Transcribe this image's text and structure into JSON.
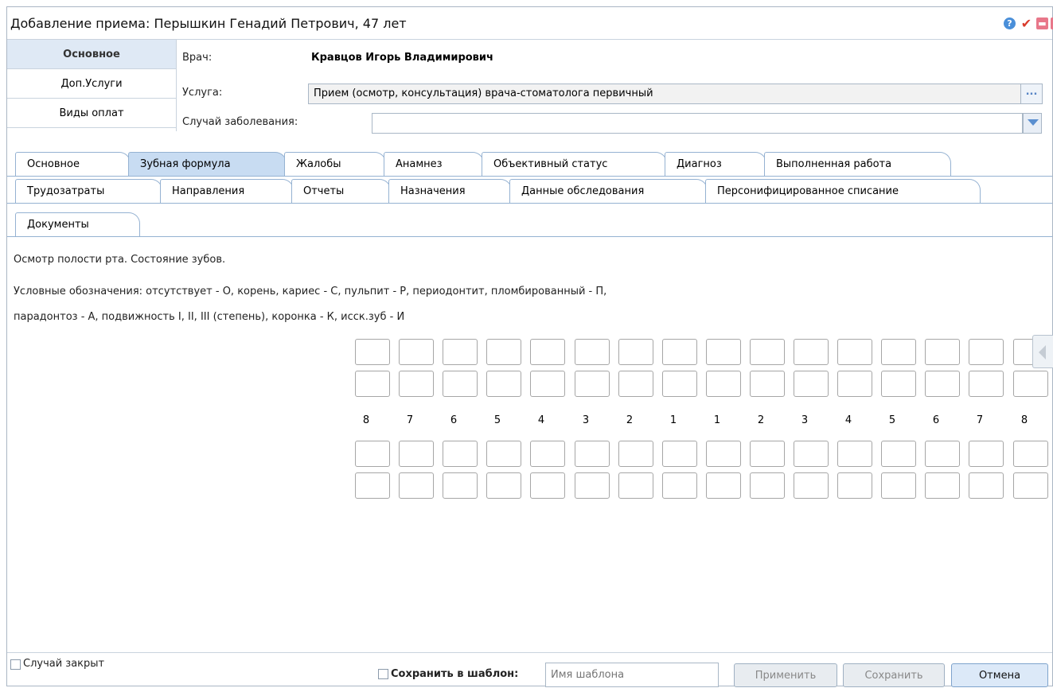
{
  "window": {
    "title": "Добавление приема: Перышкин Генадий Петрович, 47 лет"
  },
  "titlebar_icons": [
    "help-icon",
    "check-icon",
    "minimize-icon",
    "close-icon"
  ],
  "side_tabs": [
    {
      "label": "Основное",
      "active": true
    },
    {
      "label": "Доп.Услуги",
      "active": false
    },
    {
      "label": "Виды оплат",
      "active": false
    }
  ],
  "form": {
    "doctor_label": "Врач:",
    "doctor_value": "Кравцов Игорь Владимирович",
    "service_label": "Услуга:",
    "service_value": "Прием (осмотр, консультация) врача-стоматолога первичный",
    "service_button": "...",
    "case_label": "Случай заболевания:",
    "case_value": ""
  },
  "tabs": {
    "row1": [
      "Основное",
      "Зубная формула",
      "Жалобы",
      "Анамнез",
      "Объективный статус",
      "Диагноз",
      "Выполненная работа"
    ],
    "row2": [
      "Трудозатраты",
      "Направления",
      "Отчеты",
      "Назначения",
      "Данные обследования",
      "Персонифицированное списание"
    ],
    "row3": [
      "Документы"
    ],
    "active": "Зубная формула"
  },
  "content": {
    "heading": "Осмотр полости рта. Состояние зубов.",
    "legend_line1": "Условные обозначения: отсутствует - О, корень, кариес - С, пульпит - Р, периодонтит, пломбированный - П,",
    "legend_line2": "парадонтоз - А, подвижность I, II, III (степень), коронка - К, исск.зуб - И"
  },
  "tooth_numbers": [
    "8",
    "7",
    "6",
    "5",
    "4",
    "3",
    "2",
    "1",
    "1",
    "2",
    "3",
    "4",
    "5",
    "6",
    "7",
    "8"
  ],
  "footer": {
    "case_closed_label": "Случай закрыт",
    "save_template_label": "Сохранить в шаблон:",
    "template_placeholder": "Имя шаблона",
    "apply_label": "Применить",
    "save_label": "Сохранить",
    "cancel_label": "Отмена"
  },
  "colors": {
    "active_tab": "#c8dcf2",
    "tab_border": "#95b2d2",
    "side_active": "#dfe9f5"
  }
}
